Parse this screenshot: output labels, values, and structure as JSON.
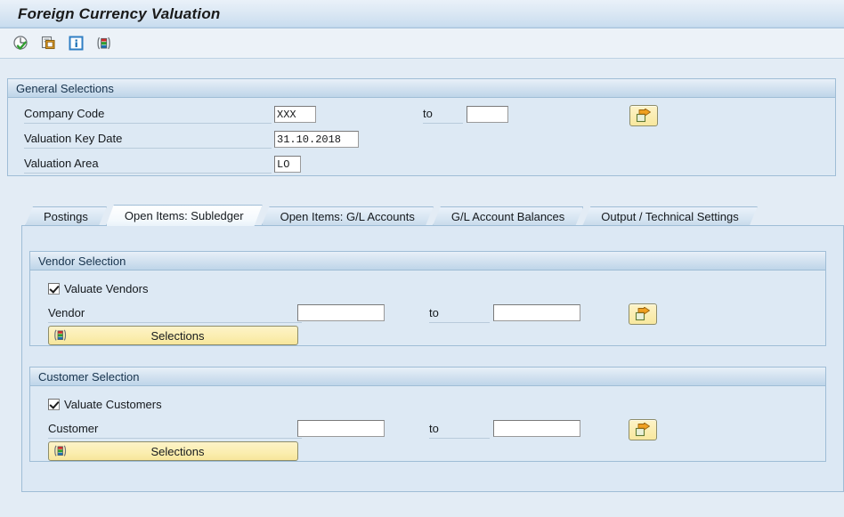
{
  "window": {
    "title": "Foreign Currency Valuation"
  },
  "toolbar": {
    "buttons": [
      {
        "name": "execute-icon",
        "tooltip": "Execute"
      },
      {
        "name": "copy-icon",
        "tooltip": "Get Variant"
      },
      {
        "name": "info-icon",
        "tooltip": "Information"
      },
      {
        "name": "multiple-selection-icon",
        "tooltip": "Selections"
      }
    ]
  },
  "general_selections": {
    "header": "General Selections",
    "rows": [
      {
        "label": "Company Code",
        "value": "XXX",
        "to_label": "to",
        "to_value": "",
        "has_multi_button": true
      },
      {
        "label": "Valuation Key Date",
        "value": "31.10.2018",
        "to_label": "",
        "to_value": "",
        "has_multi_button": false
      },
      {
        "label": "Valuation Area",
        "value": "LO",
        "to_label": "",
        "to_value": "",
        "has_multi_button": false
      }
    ]
  },
  "tabs": [
    {
      "label": "Postings",
      "active": false
    },
    {
      "label": "Open Items: Subledger",
      "active": true
    },
    {
      "label": "Open Items: G/L Accounts",
      "active": false
    },
    {
      "label": "G/L Account Balances",
      "active": false
    },
    {
      "label": "Output / Technical Settings",
      "active": false
    }
  ],
  "vendor_selection": {
    "header": "Vendor Selection",
    "checkbox_label": "Valuate Vendors",
    "checkbox_checked": true,
    "field_label": "Vendor",
    "field_value": "",
    "to_label": "to",
    "to_value": "",
    "selections_button": "Selections"
  },
  "customer_selection": {
    "header": "Customer Selection",
    "checkbox_label": "Valuate Customers",
    "checkbox_checked": true,
    "field_label": "Customer",
    "field_value": "",
    "to_label": "to",
    "to_value": "",
    "selections_button": "Selections"
  },
  "colors": {
    "page_background": "#e3ecf5",
    "panel_background": "#dde9f4",
    "panel_border": "#9fbdd6",
    "title_text": "#1a1a1a",
    "button_yellow": "#fbeeb1",
    "accent_orange": "#f0a020",
    "accent_green": "#3a9e3a",
    "accent_blue": "#1a6fb5",
    "accent_red": "#d32a2a"
  }
}
